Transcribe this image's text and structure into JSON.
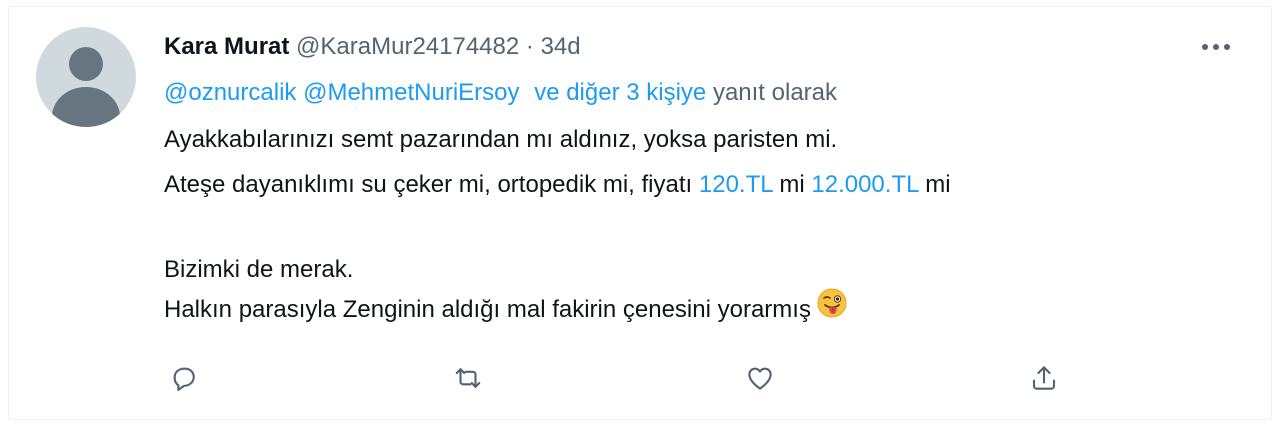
{
  "tweet": {
    "author_name": "Kara Murat",
    "author_handle": "@KaraMur24174482",
    "separator": "·",
    "time": "34d",
    "reply_to": {
      "mention1": "@oznurcalik",
      "mention2": "@MehmetNuriErsoy",
      "others": "ve diğer 3 kişiye",
      "suffix": "yanıt olarak"
    },
    "text": {
      "line1": "Ayakkabılarınızı semt pazarından mı aldınız, yoksa paristen mi.",
      "line2_a": "Ateşe dayanıklımı su çeker mi, ortopedik mi, fiyatı ",
      "line2_link1": "120.TL",
      "line2_b": " mi ",
      "line2_link2": "12.000.TL",
      "line2_c": " mi",
      "line3": "Bizimki de merak.",
      "line4": "Halkın parasıyla Zenginin aldığı mal fakirin çenesini yorarmış"
    }
  },
  "icons": {
    "more": "more-icon",
    "reply": "reply-icon",
    "retweet": "retweet-icon",
    "like": "heart-icon",
    "share": "share-icon",
    "emoji": "winking-face-with-tongue-emoji"
  },
  "colors": {
    "link": "#1d9bf0",
    "muted": "#536471",
    "text": "#0f1419",
    "avatar_bg": "#cfd9de",
    "avatar_fg": "#66757f"
  }
}
